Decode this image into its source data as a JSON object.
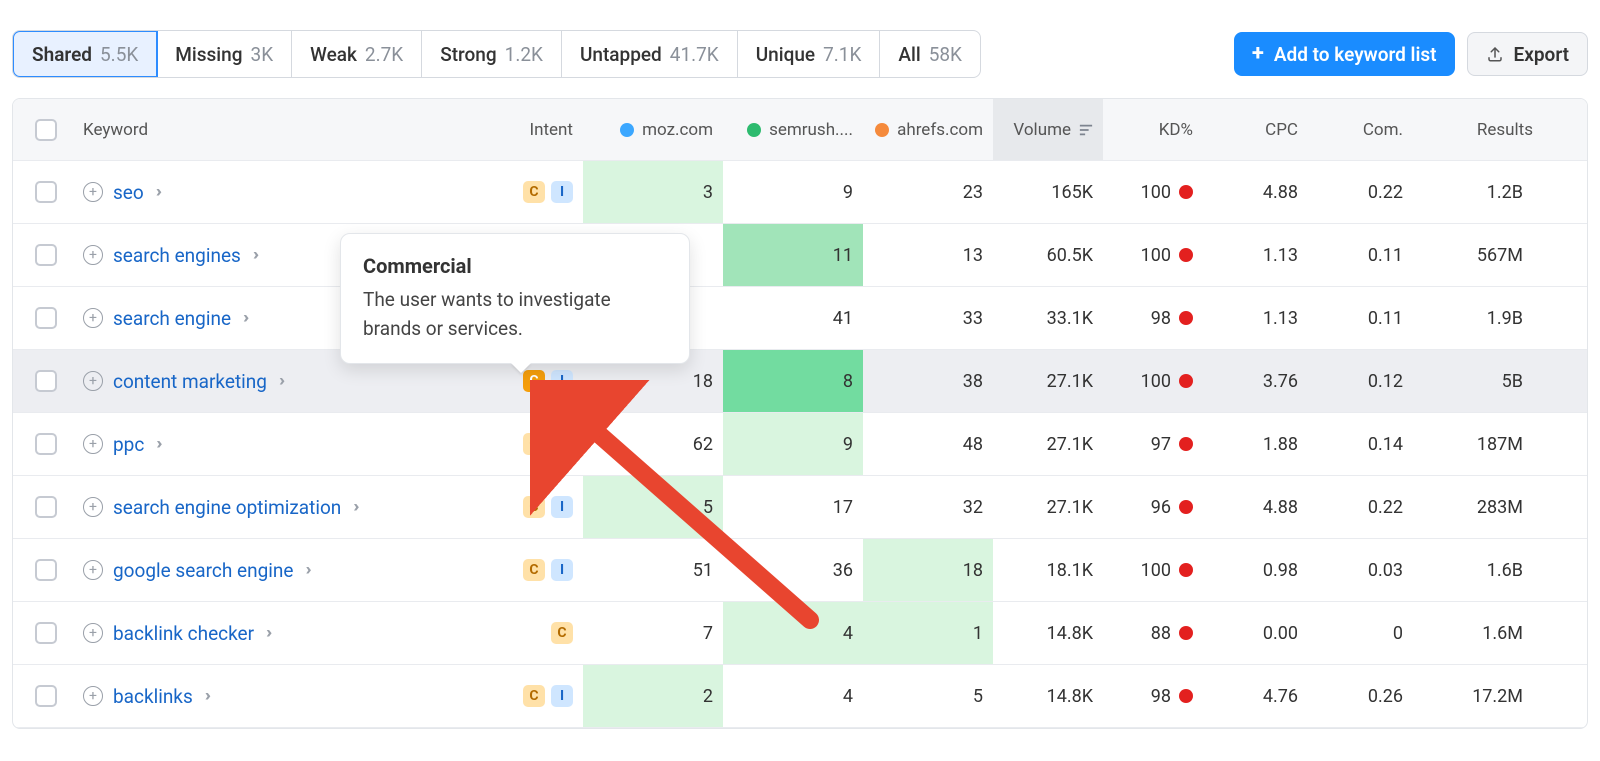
{
  "tabs": [
    {
      "label": "Shared",
      "count": "5.5K",
      "active": true
    },
    {
      "label": "Missing",
      "count": "3K"
    },
    {
      "label": "Weak",
      "count": "2.7K"
    },
    {
      "label": "Strong",
      "count": "1.2K"
    },
    {
      "label": "Untapped",
      "count": "41.7K"
    },
    {
      "label": "Unique",
      "count": "7.1K"
    },
    {
      "label": "All",
      "count": "58K"
    }
  ],
  "actions": {
    "add_label": "Add to keyword list",
    "export_label": "Export"
  },
  "columns": {
    "keyword": "Keyword",
    "intent": "Intent",
    "moz": "moz.com",
    "semrush": "semrush....",
    "ahrefs": "ahrefs.com",
    "volume": "Volume",
    "kd": "KD%",
    "cpc": "CPC",
    "com": "Com.",
    "results": "Results"
  },
  "colors": {
    "moz": "#3ba7ff",
    "semrush": "#2dbb6f",
    "ahrefs": "#f58a3c",
    "kd_dot": "#e3201f",
    "accent": "#1a8cff"
  },
  "tooltip": {
    "title": "Commercial",
    "body": "The user wants to investigate brands or services."
  },
  "rows": [
    {
      "keyword": "seo",
      "intents": [
        "C",
        "I"
      ],
      "solid_c": false,
      "moz": "3",
      "moz_hl": "hl-light",
      "semrush": "9",
      "semrush_hl": "",
      "ahrefs": "23",
      "ahrefs_hl": "",
      "volume": "165K",
      "kd": "100",
      "cpc": "4.88",
      "com": "0.22",
      "results": "1.2B"
    },
    {
      "keyword": "search engines",
      "intents": [],
      "moz": "",
      "moz_hl": "",
      "semrush": "11",
      "semrush_hl": "hl-mid",
      "ahrefs": "13",
      "ahrefs_hl": "",
      "volume": "60.5K",
      "kd": "100",
      "cpc": "1.13",
      "com": "0.11",
      "results": "567M"
    },
    {
      "keyword": "search engine",
      "intents": [],
      "moz": "",
      "moz_hl": "",
      "semrush": "41",
      "semrush_hl": "",
      "ahrefs": "33",
      "ahrefs_hl": "",
      "volume": "33.1K",
      "kd": "98",
      "cpc": "1.13",
      "com": "0.11",
      "results": "1.9B"
    },
    {
      "keyword": "content marketing",
      "hovered": true,
      "intents": [
        "C",
        "I"
      ],
      "solid_c": true,
      "moz": "18",
      "moz_hl": "",
      "semrush": "8",
      "semrush_hl": "hl-strong",
      "ahrefs": "38",
      "ahrefs_hl": "",
      "volume": "27.1K",
      "kd": "100",
      "cpc": "3.76",
      "com": "0.12",
      "results": "5B"
    },
    {
      "keyword": "ppc",
      "intents": [
        "C",
        "I"
      ],
      "solid_c": false,
      "moz": "62",
      "moz_hl": "",
      "semrush": "9",
      "semrush_hl": "hl-light",
      "ahrefs": "48",
      "ahrefs_hl": "",
      "volume": "27.1K",
      "kd": "97",
      "cpc": "1.88",
      "com": "0.14",
      "results": "187M"
    },
    {
      "keyword": "search engine optimization",
      "intents": [
        "C",
        "I"
      ],
      "solid_c": false,
      "moz": "5",
      "moz_hl": "hl-light",
      "semrush": "17",
      "semrush_hl": "",
      "ahrefs": "32",
      "ahrefs_hl": "",
      "volume": "27.1K",
      "kd": "96",
      "cpc": "4.88",
      "com": "0.22",
      "results": "283M"
    },
    {
      "keyword": "google search engine",
      "intents": [
        "C",
        "I"
      ],
      "solid_c": false,
      "moz": "51",
      "moz_hl": "",
      "semrush": "36",
      "semrush_hl": "",
      "ahrefs": "18",
      "ahrefs_hl": "hl-light",
      "volume": "18.1K",
      "kd": "100",
      "cpc": "0.98",
      "com": "0.03",
      "results": "1.6B"
    },
    {
      "keyword": "backlink checker",
      "intents": [
        "C"
      ],
      "solid_c": false,
      "moz": "7",
      "moz_hl": "",
      "semrush": "4",
      "semrush_hl": "hl-light",
      "ahrefs": "1",
      "ahrefs_hl": "hl-light",
      "volume": "14.8K",
      "kd": "88",
      "cpc": "0.00",
      "com": "0",
      "results": "1.6M"
    },
    {
      "keyword": "backlinks",
      "intents": [
        "C",
        "I"
      ],
      "solid_c": false,
      "moz": "2",
      "moz_hl": "hl-light",
      "semrush": "4",
      "semrush_hl": "",
      "ahrefs": "5",
      "ahrefs_hl": "",
      "volume": "14.8K",
      "kd": "98",
      "cpc": "4.76",
      "com": "0.26",
      "results": "17.2M"
    }
  ]
}
